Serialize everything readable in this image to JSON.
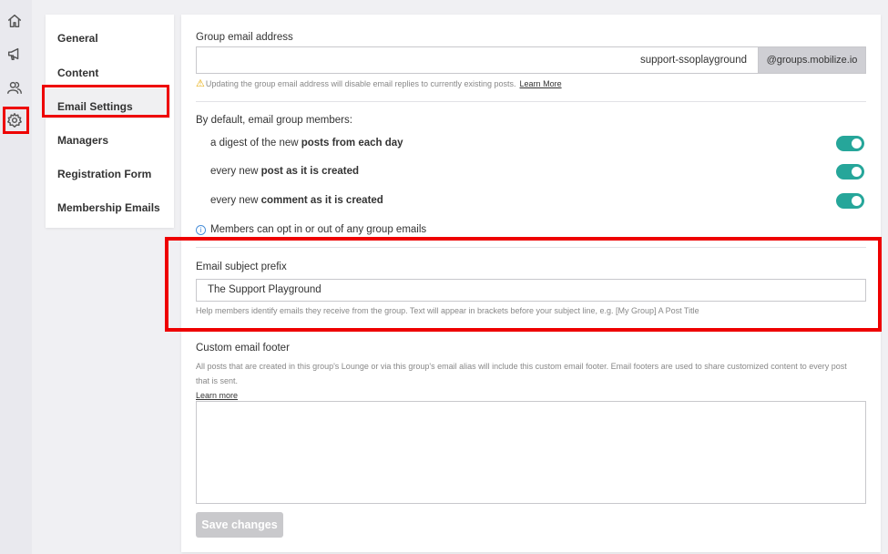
{
  "nav": {
    "icons": [
      "home-icon",
      "megaphone-icon",
      "users-icon",
      "gear-icon"
    ],
    "items": [
      {
        "label": "General"
      },
      {
        "label": "Content"
      },
      {
        "label": "Email Settings"
      },
      {
        "label": "Managers"
      },
      {
        "label": "Registration Form"
      },
      {
        "label": "Membership Emails"
      }
    ]
  },
  "group_email": {
    "label": "Group email address",
    "value": "support-ssoplayground",
    "suffix": "@groups.mobilize.io",
    "warning": "Updating the group email address will disable email replies to currently existing posts.",
    "learn_more": "Learn More"
  },
  "defaults": {
    "heading": "By default, email group members:",
    "options": [
      {
        "prefix": "a digest of the new ",
        "bold": "posts from each day",
        "enabled": true
      },
      {
        "prefix": "every new ",
        "bold": "post as it is created",
        "enabled": true
      },
      {
        "prefix": "every new ",
        "bold": "comment as it is created",
        "enabled": true
      }
    ],
    "info": "Members can opt in or out of any group emails"
  },
  "subject_prefix": {
    "label": "Email subject prefix",
    "value": "The Support Playground",
    "help": "Help members identify emails they receive from the group. Text will appear in brackets before your subject line, e.g. [My Group] A Post Title"
  },
  "custom_footer": {
    "label": "Custom email footer",
    "description": "All posts that are created in this group's Lounge or via this group's email alias will include this custom email footer. Email footers are used to share customized content to every post that is sent.",
    "learn_more": "Learn more",
    "value": ""
  },
  "save_label": "Save changes",
  "colors": {
    "accent": "#26a69a",
    "highlight": "#ee0000"
  }
}
